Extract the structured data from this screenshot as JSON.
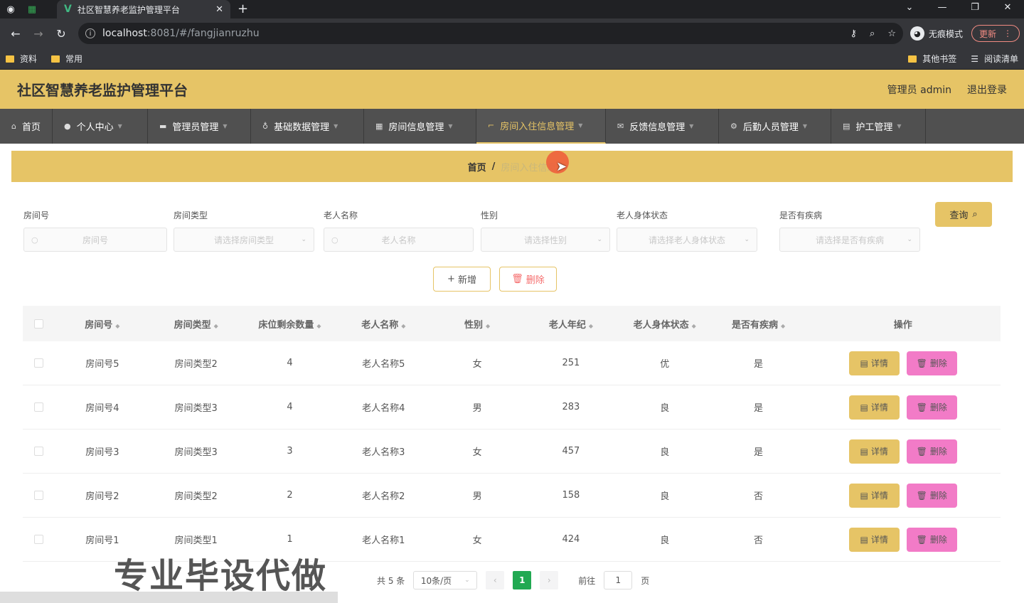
{
  "browser": {
    "tab_title": "社区智慧养老监护管理平台",
    "url_host": "localhost",
    "url_path": ":8081/#/fangjianruzhu",
    "incognito_label": "无痕模式",
    "update_label": "更新",
    "bookmarks": [
      "资料",
      "常用"
    ],
    "bookmarks_right": [
      "其他书签",
      "阅读清单"
    ]
  },
  "header": {
    "title": "社区智慧养老监护管理平台",
    "user": "管理员 admin",
    "logout": "退出登录"
  },
  "menu": [
    {
      "label": "首页",
      "icon": "home-icon"
    },
    {
      "label": "个人中心",
      "icon": "user-icon"
    },
    {
      "label": "管理员管理",
      "icon": "admin-icon"
    },
    {
      "label": "基础数据管理",
      "icon": "mic-icon"
    },
    {
      "label": "房间信息管理",
      "icon": "grid-icon"
    },
    {
      "label": "房间入住信息管理",
      "icon": "crop-icon"
    },
    {
      "label": "反馈信息管理",
      "icon": "mail-icon"
    },
    {
      "label": "后勤人员管理",
      "icon": "settings-icon"
    },
    {
      "label": "护工管理",
      "icon": "printer-icon"
    }
  ],
  "breadcrumb": {
    "home": "首页",
    "separator": "/",
    "current": "房间入住信息"
  },
  "search": {
    "fields": [
      {
        "label": "房间号",
        "placeholder": "房间号"
      },
      {
        "label": "房间类型",
        "placeholder": "请选择房间类型"
      },
      {
        "label": "老人名称",
        "placeholder": "老人名称"
      },
      {
        "label": "性别",
        "placeholder": "请选择性别"
      },
      {
        "label": "老人身体状态",
        "placeholder": "请选择老人身体状态"
      },
      {
        "label": "是否有疾病",
        "placeholder": "请选择是否有疾病"
      }
    ],
    "query_label": "查询"
  },
  "actions": {
    "add": "新增",
    "delete": "删除"
  },
  "table": {
    "columns": [
      "房间号",
      "房间类型",
      "床位剩余数量",
      "老人名称",
      "性别",
      "老人年纪",
      "老人身体状态",
      "是否有疾病",
      "操作"
    ],
    "rows": [
      [
        "房间号5",
        "房间类型2",
        "4",
        "老人名称5",
        "女",
        "251",
        "优",
        "是"
      ],
      [
        "房间号4",
        "房间类型3",
        "4",
        "老人名称4",
        "男",
        "283",
        "良",
        "是"
      ],
      [
        "房间号3",
        "房间类型3",
        "3",
        "老人名称3",
        "女",
        "457",
        "良",
        "是"
      ],
      [
        "房间号2",
        "房间类型2",
        "2",
        "老人名称2",
        "男",
        "158",
        "良",
        "否"
      ],
      [
        "房间号1",
        "房间类型1",
        "1",
        "老人名称1",
        "女",
        "424",
        "良",
        "否"
      ]
    ],
    "detail_label": "详情",
    "delete_label": "删除"
  },
  "pagination": {
    "total": "共 5 条",
    "page_size": "10条/页",
    "current_page": "1",
    "goto_prefix": "前往",
    "goto_value": "1",
    "goto_suffix": "页"
  },
  "watermark": "专业毕设代做"
}
